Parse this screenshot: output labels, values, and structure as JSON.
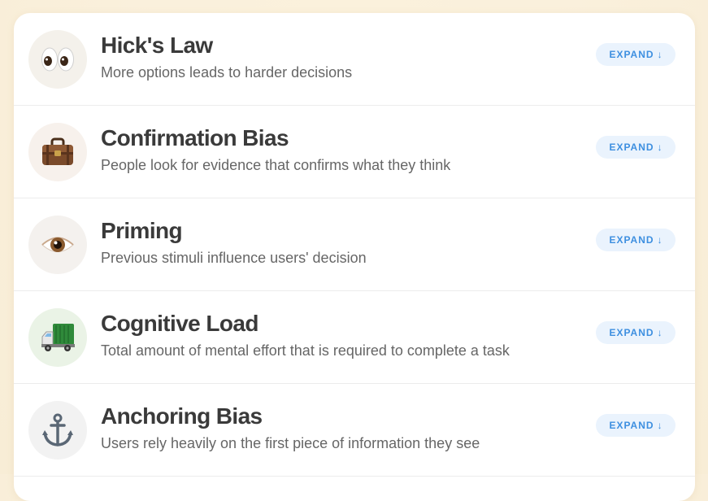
{
  "items": [
    {
      "title": "Hick's Law",
      "description": "More options leads to harder decisions",
      "icon": "eyes-icon",
      "icon_bg": "#f4f1eb",
      "button_label": "EXPAND",
      "button_arrow": "↓"
    },
    {
      "title": "Confirmation Bias",
      "description": "People look for evidence that confirms what they think",
      "icon": "briefcase-icon",
      "icon_bg": "#f7f1ec",
      "button_label": "EXPAND",
      "button_arrow": "↓"
    },
    {
      "title": "Priming",
      "description": "Previous stimuli influence users' decision",
      "icon": "eye-icon",
      "icon_bg": "#f4f1ee",
      "button_label": "EXPAND",
      "button_arrow": "↓"
    },
    {
      "title": "Cognitive Load",
      "description": "Total amount of mental effort that is required to complete a task",
      "icon": "truck-icon",
      "icon_bg": "#eaf3e6",
      "button_label": "EXPAND",
      "button_arrow": "↓"
    },
    {
      "title": "Anchoring Bias",
      "description": "Users rely heavily on the first piece of information they see",
      "icon": "anchor-icon",
      "icon_bg": "#f2f2f2",
      "button_label": "EXPAND",
      "button_arrow": "↓"
    }
  ],
  "colors": {
    "button_bg": "#eaf3fd",
    "button_text": "#3d8fe0",
    "title_text": "#3a3a3a",
    "desc_text": "#666666"
  }
}
